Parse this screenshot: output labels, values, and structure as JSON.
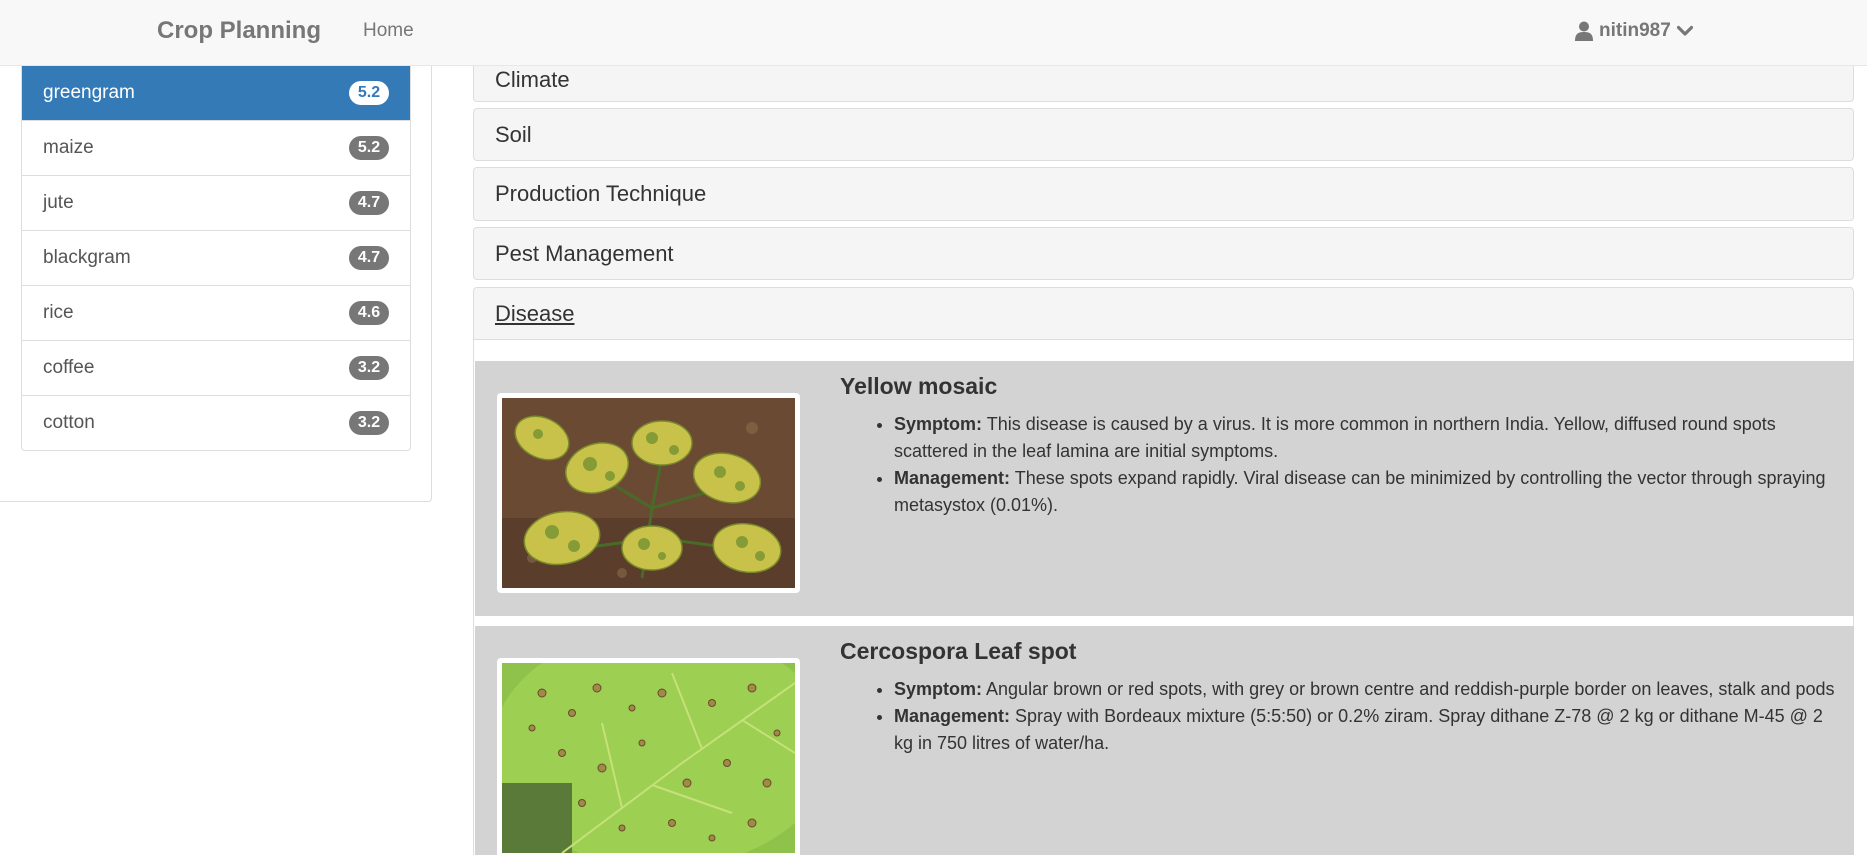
{
  "navbar": {
    "brand": "Crop Planning",
    "home_label": "Home",
    "user_icon": "user-icon",
    "username": "nitin987",
    "dropdown_icon": "chevron-down-icon"
  },
  "sidebar": {
    "crops": [
      {
        "name": "greengram",
        "score": "5.2",
        "active": true
      },
      {
        "name": "maize",
        "score": "5.2"
      },
      {
        "name": "jute",
        "score": "4.7"
      },
      {
        "name": "blackgram",
        "score": "4.7"
      },
      {
        "name": "rice",
        "score": "4.6"
      },
      {
        "name": "coffee",
        "score": "3.2"
      },
      {
        "name": "cotton",
        "score": "3.2"
      }
    ]
  },
  "main": {
    "sections": [
      {
        "title": "Climate"
      },
      {
        "title": "Soil"
      },
      {
        "title": "Production Technique"
      },
      {
        "title": "Pest Management"
      },
      {
        "title": "Disease",
        "open": true
      }
    ],
    "diseases": [
      {
        "name": "Yellow mosaic",
        "symptom_label": "Symptom:",
        "symptom": "This disease is caused by a virus. It is more common in northern India. Yellow, diffused round spots scattered in the leaf lamina are initial symptoms.",
        "management_label": "Management:",
        "management": "These spots expand rapidly. Viral disease can be minimized by controlling the vector through spraying metasystox (0.01%)."
      },
      {
        "name": "Cercospora Leaf spot",
        "symptom_label": "Symptom:",
        "symptom": "Angular brown or red spots, with grey or brown centre and reddish-purple border on leaves, stalk and pods",
        "management_label": "Management:",
        "management": "Spray with Bordeaux mixture (5:5:50) or 0.2% ziram. Spray dithane Z-78 @ 2 kg or dithane M-45 @ 2 kg in 750 litres of water/ha."
      }
    ]
  },
  "colors": {
    "active": "#337ab7",
    "badge": "#777777",
    "disease_bg": "#d3d3d3",
    "navbar_bg": "#f8f8f8"
  }
}
